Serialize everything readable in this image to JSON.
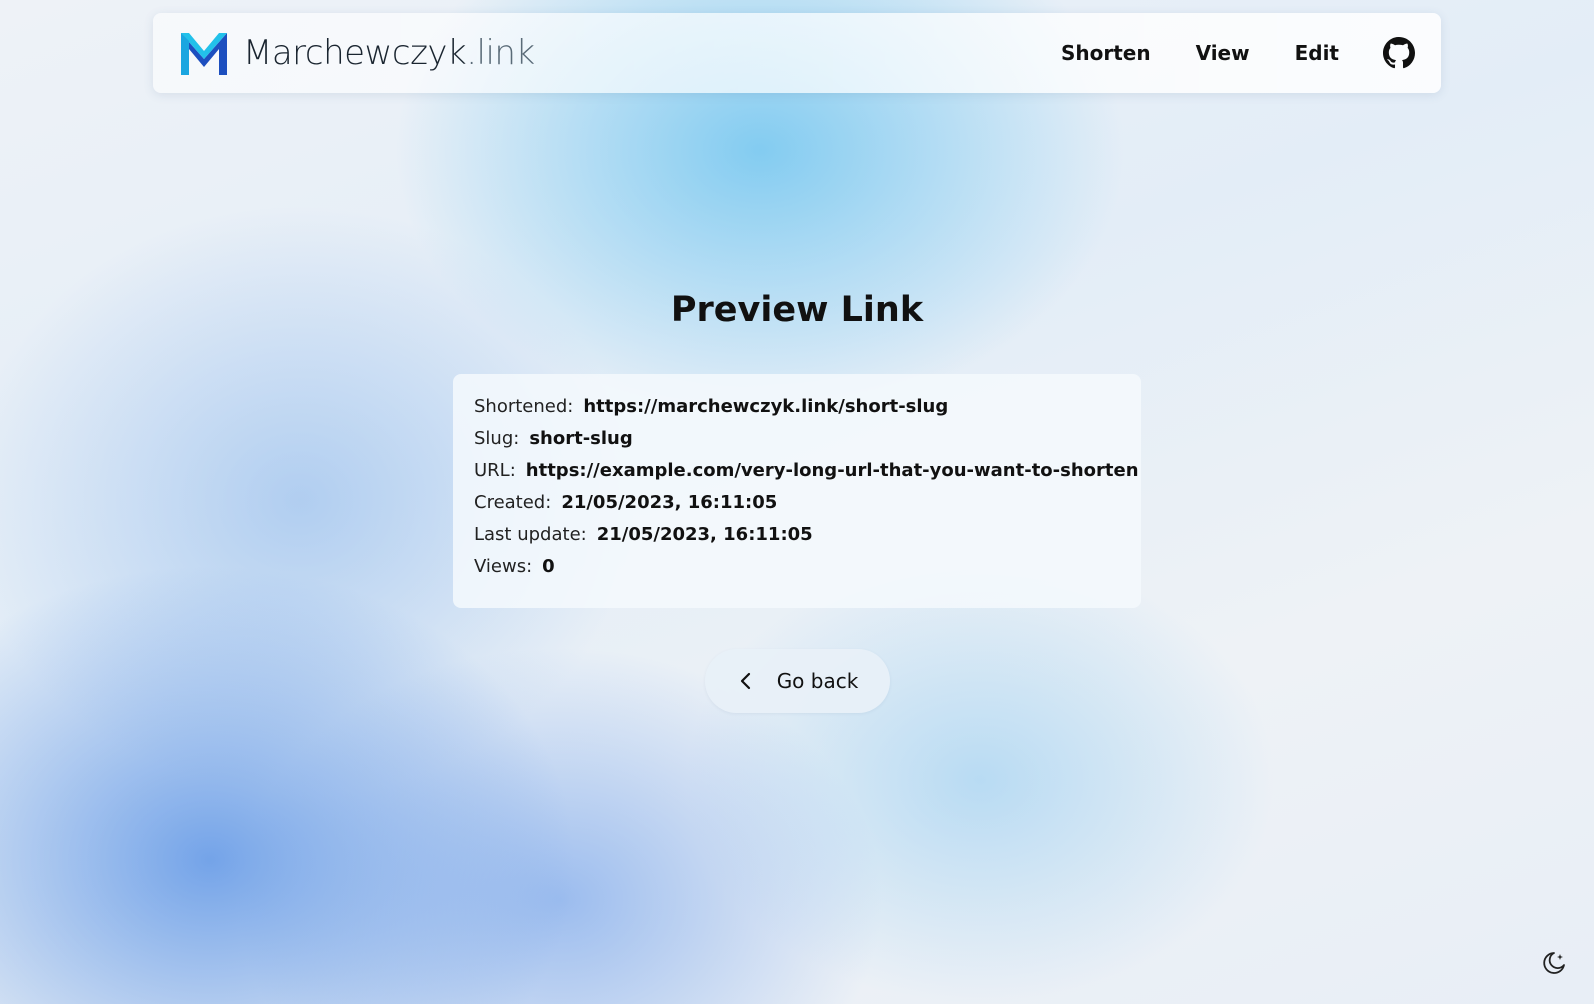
{
  "brand": {
    "name": "Marchewczyk",
    "tld": ".link"
  },
  "nav": {
    "links": [
      {
        "label": "Shorten"
      },
      {
        "label": "View"
      },
      {
        "label": "Edit"
      }
    ],
    "github_icon": "github-icon"
  },
  "page": {
    "title": "Preview Link"
  },
  "details": {
    "shortened": {
      "label": "Shortened:",
      "value": "https://marchewczyk.link/short-slug"
    },
    "slug": {
      "label": "Slug:",
      "value": "short-slug"
    },
    "url": {
      "label": "URL:",
      "value": "https://example.com/very-long-url-that-you-want-to-shorten"
    },
    "created": {
      "label": "Created:",
      "value": "21/05/2023, 16:11:05"
    },
    "last_update": {
      "label": "Last update:",
      "value": "21/05/2023, 16:11:05"
    },
    "views": {
      "label": "Views:",
      "value": "0"
    }
  },
  "back_button": {
    "label": "Go back",
    "icon": "chevron-left-icon"
  },
  "theme_toggle": {
    "icon": "moon-icon"
  },
  "colors": {
    "logo_light": "#1fb6e6",
    "logo_dark": "#1d4fbf"
  }
}
